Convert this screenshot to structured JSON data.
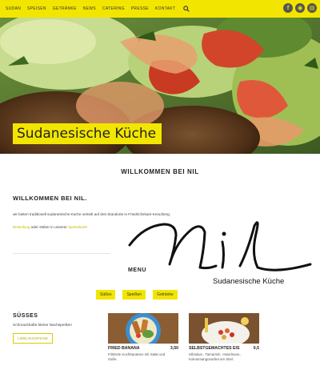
{
  "nav": {
    "items": [
      "Sudan",
      "Speisen",
      "Getränke",
      "News",
      "Catering",
      "Presse",
      "Kontakt"
    ],
    "search_icon": "search-icon",
    "social": [
      {
        "icon": "facebook-icon",
        "glyph": "f"
      },
      {
        "icon": "tripadvisor-icon",
        "glyph": "◉"
      },
      {
        "icon": "burger-icon",
        "glyph": "▤"
      }
    ],
    "bg_color": "#f2e600"
  },
  "hero": {
    "title": "Sudanesische Küche"
  },
  "welcome": {
    "heading": "WILLKOMMEN BEI NIL",
    "section_heading": "WILLKOMMEN BEI NIL.",
    "intro": "wir bieten traditionell sudanesische Küche verteilt auf drei Standorte in Friedrichshain-Kreuzberg.",
    "links": {
      "link1": "Bestellung",
      "middle": " oder stöber in unserer ",
      "link2": "Speisekarte"
    }
  },
  "logo": {
    "subtitle": "Sudanesische Küche"
  },
  "menu": {
    "label": "MENU",
    "categories": [
      "Süßes",
      "Speißen",
      "Getränke"
    ]
  },
  "sweets": {
    "heading": "SÜSSES",
    "description": "Schmackhafte kleine Nachspeißen",
    "button": "Lieblingspeise"
  },
  "cards": [
    {
      "title": "FRIED BANANA",
      "price": "3,50",
      "description": "Frittierte Kochbananen mit Salat und Soße."
    },
    {
      "title": "SELBSTGEMACHTES EIS",
      "price": "0,5",
      "description": "Hibiskus-, Tamarind-, Haselnuss-, Kokosmangosorbet am Stiel."
    }
  ]
}
